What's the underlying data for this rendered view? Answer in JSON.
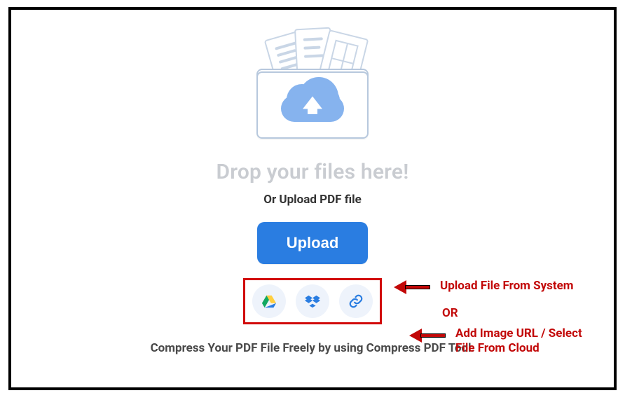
{
  "drop_text": "Drop your files here!",
  "or_text": "Or Upload PDF file",
  "upload_button_label": "Upload",
  "cloud_sources": {
    "drive": "google-drive-icon",
    "dropbox": "dropbox-icon",
    "link": "link-icon"
  },
  "footer": "Compress Your PDF File Freely by using Compress PDF Tool.",
  "annotations": {
    "upload_from_system": "Upload File From System",
    "or": "OR",
    "add_url_line1": "Add Image URL / Select",
    "add_url_line2": "File From Cloud"
  },
  "colors": {
    "primary": "#2a7de1",
    "annotation": "#c20808",
    "muted": "#c9ccd1"
  }
}
